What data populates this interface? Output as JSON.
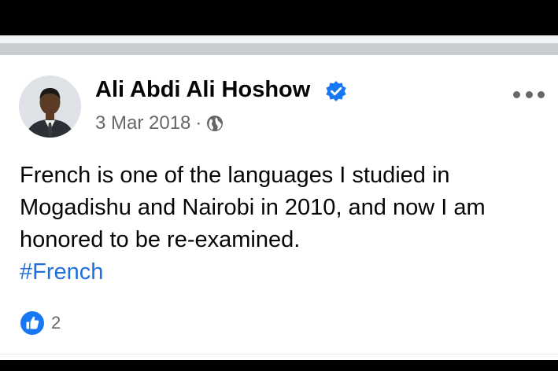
{
  "post": {
    "author": "Ali Abdi Ali Hoshow",
    "timestamp": "3 Mar 2018",
    "separator": "·",
    "lines": [
      "French is one of the languages I studied in",
      "Mogadishu and Nairobi in 2010, and now I am",
      "honored to be re-examined."
    ],
    "hashtag": "#French",
    "reaction_count": "2"
  },
  "icons": {
    "verified": "verified-badge-icon",
    "audience": "globe-icon",
    "reaction": "like-icon",
    "menu": "more-options-icon"
  },
  "colors": {
    "link": "#216fdb",
    "verified": "#1877f2",
    "like": "#1877f2"
  }
}
